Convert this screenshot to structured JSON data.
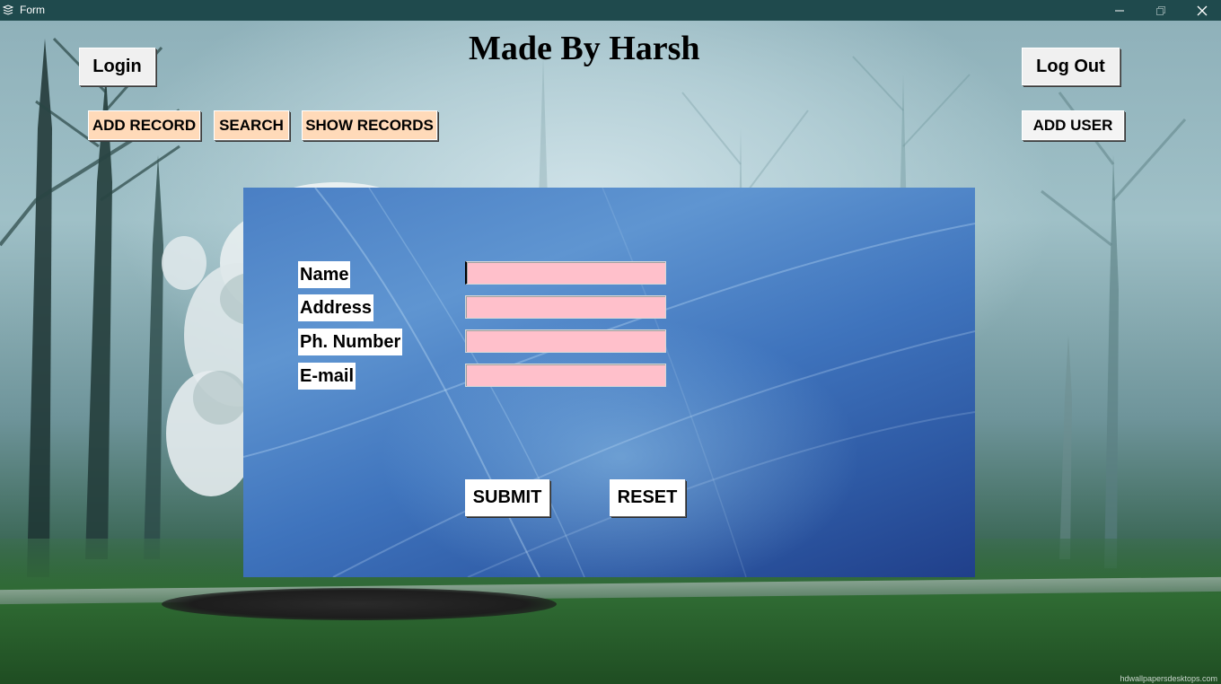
{
  "window": {
    "title": "Form",
    "app_icon": "stack-icon"
  },
  "header": {
    "heading": "Made By Harsh"
  },
  "toolbar": {
    "login_label": "Login",
    "logout_label": "Log Out",
    "add_record_label": "ADD RECORD",
    "search_label": "SEARCH",
    "show_records_label": "SHOW RECORDS",
    "add_user_label": "ADD USER"
  },
  "form": {
    "fields": [
      {
        "label": "Name",
        "value": ""
      },
      {
        "label": "Address",
        "value": ""
      },
      {
        "label": "Ph. Number",
        "value": ""
      },
      {
        "label": "E-mail",
        "value": ""
      }
    ],
    "submit_label": "SUBMIT",
    "reset_label": "RESET"
  },
  "watermark": "hdwallpapersdesktops.com",
  "colors": {
    "titlebar": "#1f4a4d",
    "field_bg": "#ffc0cb",
    "nav_button_bg": "#ffdab9",
    "panel_blue": "#3f74bd"
  }
}
